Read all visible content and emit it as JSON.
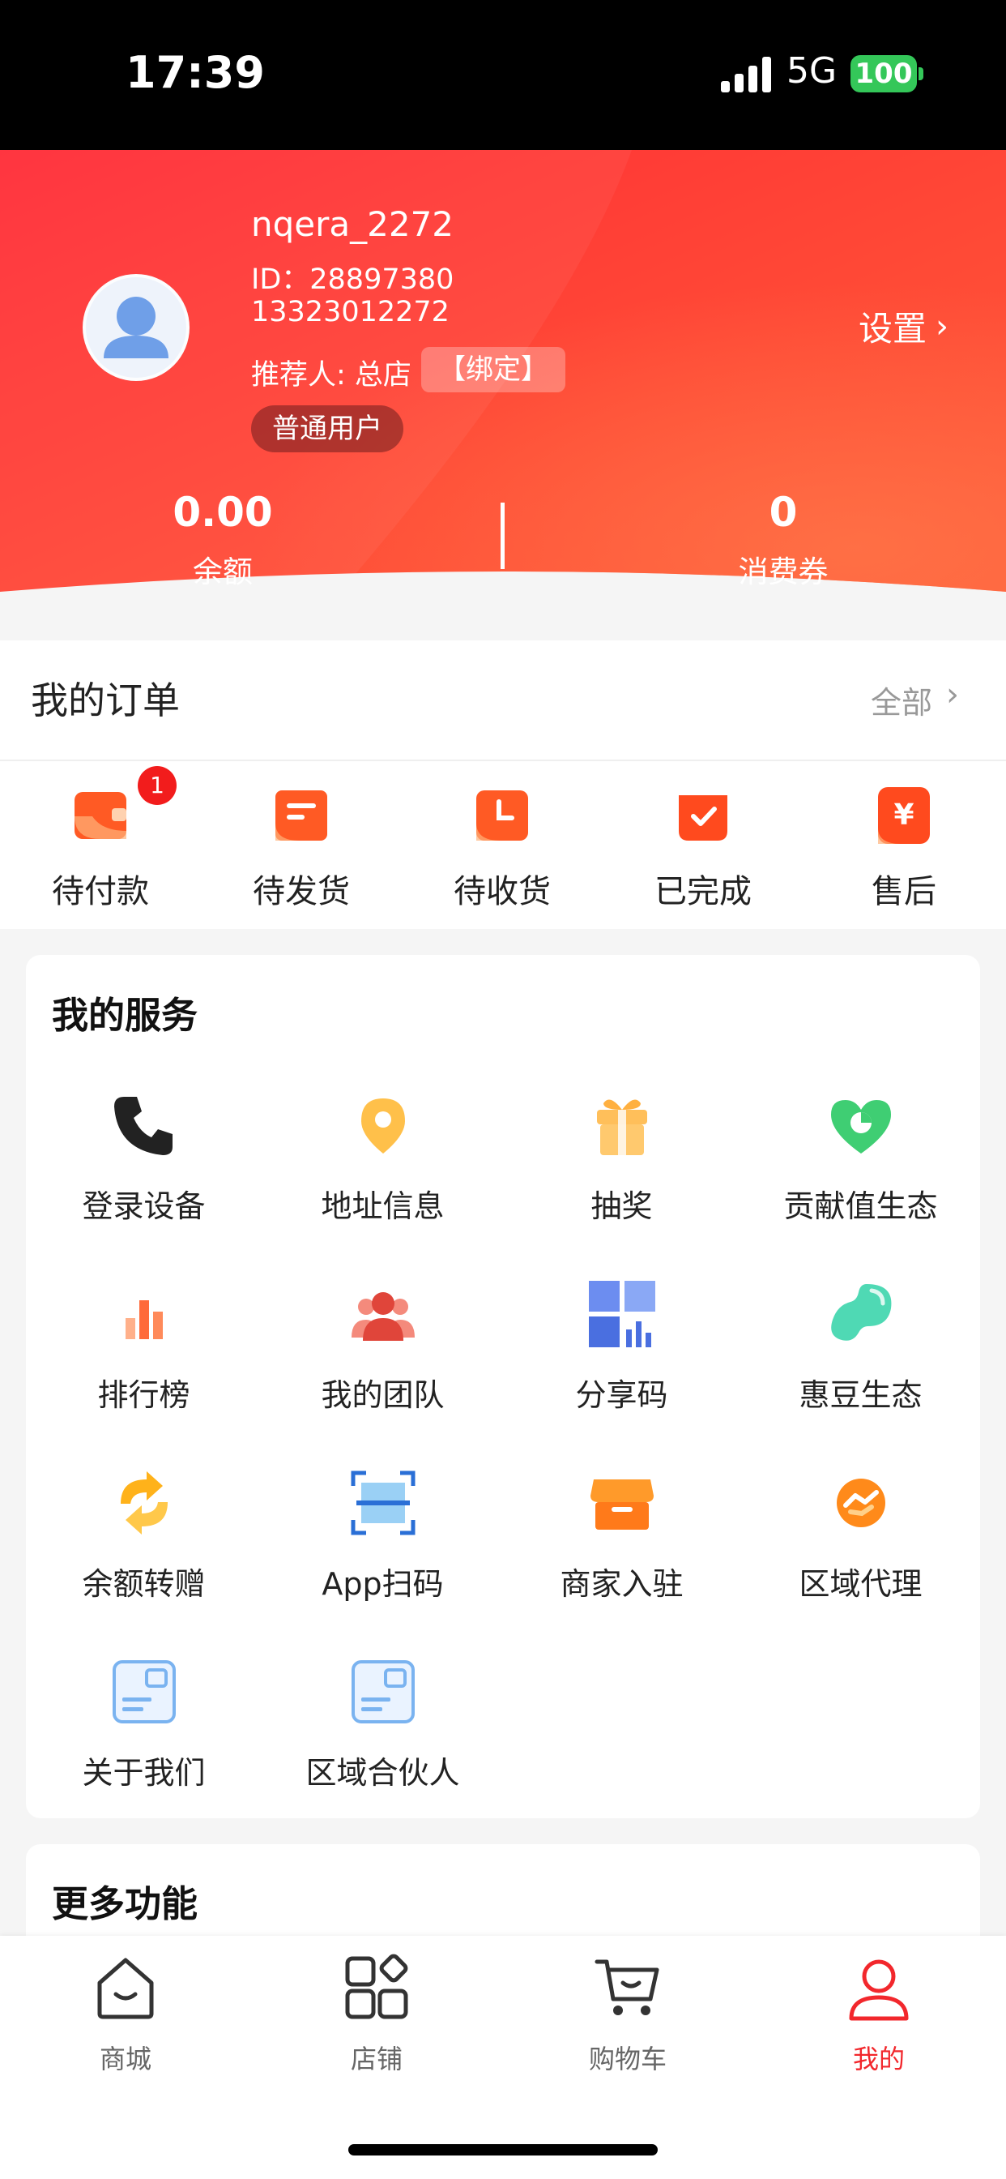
{
  "status_bar": {
    "time": "17:39",
    "network": "5G",
    "battery": "100"
  },
  "profile": {
    "username": "nqera_2272",
    "user_id": "ID：28897380",
    "phone": "13323012272",
    "referrer": "推荐人: 总店",
    "bind_label": "【绑定】",
    "level": "普通用户",
    "settings_label": "设置"
  },
  "stats": {
    "balance_value": "0.00",
    "balance_label": "余额",
    "voucher_value": "0",
    "voucher_label": "消费券"
  },
  "orders": {
    "title": "我的订单",
    "all_label": "全部",
    "items": [
      {
        "label": "待付款",
        "icon": "wallet-icon",
        "badge": "1"
      },
      {
        "label": "待发货",
        "icon": "ship-box-icon"
      },
      {
        "label": "待收货",
        "icon": "clock-box-icon"
      },
      {
        "label": "已完成",
        "icon": "check-box-icon"
      },
      {
        "label": "售后",
        "icon": "yen-icon"
      }
    ]
  },
  "services": {
    "title": "我的服务",
    "items": [
      {
        "label": "登录设备",
        "icon": "phone-icon"
      },
      {
        "label": "地址信息",
        "icon": "location-pin-icon"
      },
      {
        "label": "抽奖",
        "icon": "gift-icon"
      },
      {
        "label": "贡献值生态",
        "icon": "heart-icon"
      },
      {
        "label": "排行榜",
        "icon": "bar-chart-icon"
      },
      {
        "label": "我的团队",
        "icon": "team-icon"
      },
      {
        "label": "分享码",
        "icon": "qr-code-icon"
      },
      {
        "label": "惠豆生态",
        "icon": "bean-icon"
      },
      {
        "label": "余额转赠",
        "icon": "transfer-icon"
      },
      {
        "label": "App扫码",
        "icon": "scan-icon"
      },
      {
        "label": "商家入驻",
        "icon": "store-icon"
      },
      {
        "label": "区域代理",
        "icon": "handshake-icon"
      },
      {
        "label": "关于我们",
        "icon": "card-icon"
      },
      {
        "label": "区域合伙人",
        "icon": "card-icon"
      }
    ]
  },
  "more": {
    "title": "更多功能"
  },
  "tabbar": {
    "items": [
      {
        "label": "商城",
        "icon": "home-icon"
      },
      {
        "label": "店铺",
        "icon": "shop-grid-icon"
      },
      {
        "label": "购物车",
        "icon": "cart-icon"
      },
      {
        "label": "我的",
        "icon": "profile-icon",
        "active": true
      }
    ],
    "active_color": "#f2272c",
    "inactive_color": "#666666"
  },
  "colors": {
    "brand_red": "#f52a2a",
    "accent_orange": "#ff6a2b"
  }
}
